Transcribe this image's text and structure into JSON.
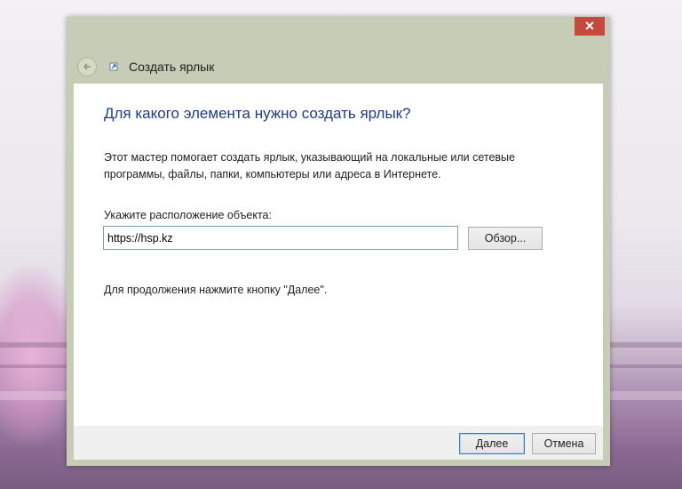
{
  "window": {
    "title": "Создать ярлык",
    "close_label": "✕"
  },
  "wizard": {
    "heading": "Для какого элемента нужно создать ярлык?",
    "description": "Этот мастер помогает создать ярлык, указывающий на локальные или сетевые программы, файлы, папки, компьютеры или адреса в Интернете.",
    "location_label": "Укажите расположение объекта:",
    "location_value": "https://hsp.kz",
    "browse_label": "Обзор...",
    "hint": "Для продолжения нажмите кнопку \"Далее\"."
  },
  "footer": {
    "next_label": "Далее",
    "cancel_label": "Отмена"
  },
  "icons": {
    "back": "back-arrow-icon",
    "app": "shortcut-icon",
    "close": "close-icon"
  },
  "colors": {
    "window_frame": "#c6cdb7",
    "heading": "#1e3a8a",
    "close_button": "#c7483d"
  }
}
